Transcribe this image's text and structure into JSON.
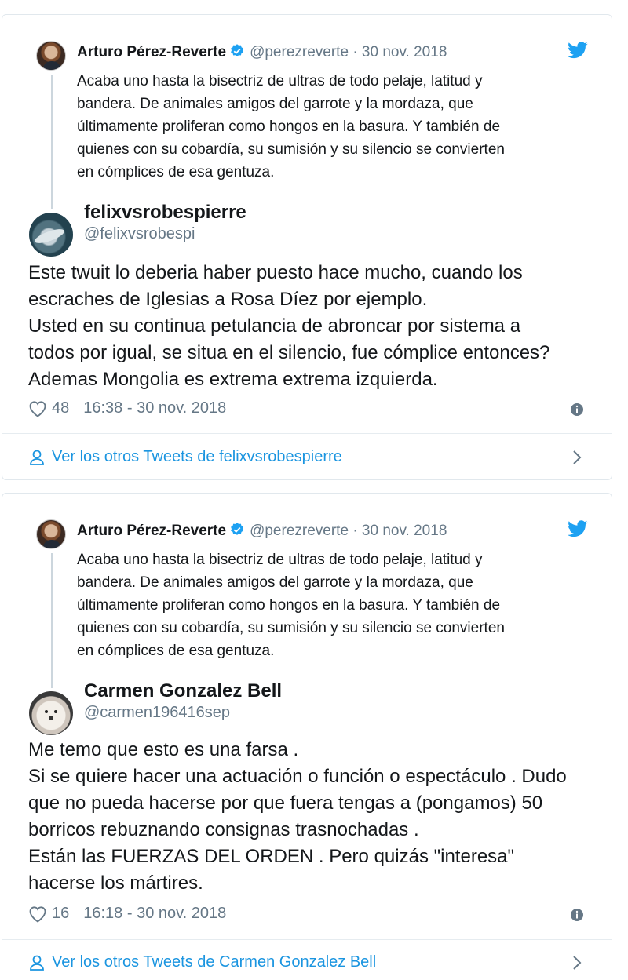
{
  "cards": [
    {
      "quoted": {
        "name": "Arturo Pérez-Reverte",
        "handle": "@perezreverte",
        "separator": "·",
        "date": "30 nov. 2018",
        "text": "Acaba uno hasta la bisectriz de ultras de todo pelaje, latitud y\nbandera. De animales amigos del garrote y la mordaza, que\núltimamente proliferan como hongos en la basura. Y también de\nquienes con su cobardía, su sumisión y su silencio se convierten\nen cómplices de esa gentuza."
      },
      "reply": {
        "name": "felixvsrobespierre",
        "handle": "@felixvsrobespi",
        "text": "Este twuit lo deberia haber puesto hace mucho, cuando los\nescraches de Iglesias a Rosa Díez por ejemplo.\nUsted en su continua petulancia de abroncar por sistema a\ntodos por igual, se situa en el silencio,  fue cómplice entonces?\nAdemas Mongolia es extrema extrema izquierda.",
        "likes": "48",
        "timestamp": "16:38 - 30 nov. 2018"
      },
      "footer": "Ver los otros Tweets de felixvsrobespierre"
    },
    {
      "quoted": {
        "name": "Arturo Pérez-Reverte",
        "handle": "@perezreverte",
        "separator": "·",
        "date": "30 nov. 2018",
        "text": "Acaba uno hasta la bisectriz de ultras de todo pelaje, latitud y\nbandera. De animales amigos del garrote y la mordaza, que\núltimamente proliferan como hongos en la basura. Y también de\nquienes con su cobardía, su sumisión y su silencio se convierten\nen cómplices de esa gentuza."
      },
      "reply": {
        "name": "Carmen Gonzalez Bell",
        "handle": "@carmen196416sep",
        "text": "Me temo que esto es una farsa .\nSi se quiere hacer una actuación o función o espectáculo . Dudo\nque no pueda hacerse por que fuera tengas a (pongamos) 50\nborricos rebuznando consignas trasnochadas .\nEstán las FUERZAS DEL ORDEN . Pero quizás \"interesa\"\nhacerse los mártires.",
        "likes": "16",
        "timestamp": "16:18 - 30 nov. 2018"
      },
      "footer": "Ver los otros Tweets de Carmen Gonzalez Bell"
    }
  ],
  "colors": {
    "link": "#1b95e0",
    "muted": "#657786",
    "border": "#e1e8ed",
    "verified": "#1da1f2"
  },
  "icons": [
    "verified-badge-icon",
    "twitter-bird-icon",
    "heart-icon",
    "info-icon",
    "person-icon",
    "chevron-right-icon"
  ]
}
